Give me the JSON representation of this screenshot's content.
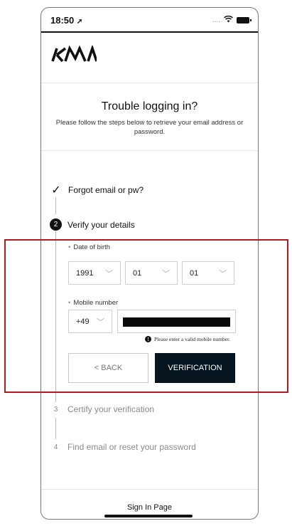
{
  "status_bar": {
    "time": "18:50",
    "location_icon": "location-arrow-icon",
    "signal": "....",
    "wifi_icon": "wifi-icon",
    "battery_icon": "battery-icon"
  },
  "brand": {
    "logo_text": "KIA"
  },
  "header": {
    "title": "Trouble logging in?",
    "subtitle_line1": "Please follow the steps below to retrieve your email address or",
    "subtitle_line2": "password."
  },
  "steps": [
    {
      "marker": "✓",
      "label": "Forgot email or pw?",
      "state": "done"
    },
    {
      "marker": "2",
      "label": "Verify your details",
      "state": "active"
    },
    {
      "marker": "3",
      "label": "Certify your verification",
      "state": "pending"
    },
    {
      "marker": "4",
      "label": "Find email or reset your password",
      "state": "pending"
    }
  ],
  "form": {
    "dob_label": "Date of birth",
    "dob_year": "1991",
    "dob_month": "01",
    "dob_day": "01",
    "mobile_label": "Mobile number",
    "country_code": "+49",
    "mobile_hint": "Please enter a valid mobile number.",
    "back_button": "< BACK",
    "verify_button": "VERIFICATION"
  },
  "footer": {
    "link": "Sign In Page"
  },
  "colors": {
    "highlight": "#b2191e",
    "primary_button": "#05141f"
  }
}
